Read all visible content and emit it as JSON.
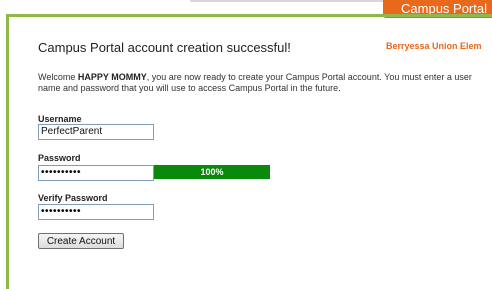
{
  "header": {
    "portal_tab": "Campus Portal"
  },
  "main": {
    "heading": "Campus Portal account creation successful!",
    "district": "Berryessa Union Elem",
    "welcome_prefix": "Welcome ",
    "user_name": "HAPPY MOMMY",
    "welcome_rest": ", you are now ready to create your Campus Portal account. You must enter a user name and password that you will use to access Campus Portal in the future."
  },
  "form": {
    "username_label": "Username",
    "username_value": "PerfectParent",
    "password_label": "Password",
    "password_value": "••••••••••",
    "strength_text": "100%",
    "strength_percent": 100,
    "verify_label": "Verify Password",
    "verify_value": "••••••••••",
    "submit_label": "Create Account"
  },
  "colors": {
    "accent_orange": "#e8681c",
    "frame_green": "#8fb84a",
    "strength_green": "#0a8a0a"
  }
}
